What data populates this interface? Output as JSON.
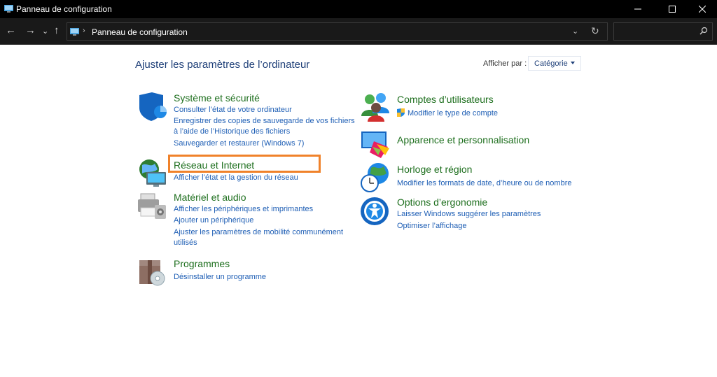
{
  "window": {
    "title": "Panneau de configuration",
    "controls": {
      "minimize": "—",
      "maximize": "☐",
      "close": "✕"
    }
  },
  "navbar": {
    "back": "←",
    "forward": "→",
    "recent": "⌄",
    "up": "↑",
    "breadcrumb_sep": "›",
    "breadcrumb": "Panneau de configuration",
    "address_dropdown": "⌄",
    "refresh": "↻",
    "search_placeholder": ""
  },
  "main": {
    "heading": "Ajuster les paramètres de l’ordinateur",
    "view_by_label": "Afficher par :",
    "view_by_value": "Catégorie"
  },
  "left_categories": [
    {
      "title": "Système et sécurité",
      "links": [
        "Consulter l’état de votre ordinateur",
        "Enregistrer des copies de sauvegarde de vos fichiers",
        "à l’aide de l’Historique des fichiers",
        "Sauvegarder et restaurer (Windows 7)"
      ]
    },
    {
      "title": "Réseau et Internet",
      "links": [
        "Afficher l’état et la gestion du réseau"
      ]
    },
    {
      "title": "Matériel et audio",
      "links": [
        "Afficher les périphériques et imprimantes",
        "Ajouter un périphérique",
        "Ajuster les paramètres de mobilité communément",
        "utilisés"
      ]
    },
    {
      "title": "Programmes",
      "links": [
        "Désinstaller un programme"
      ]
    }
  ],
  "right_categories": [
    {
      "title": "Comptes d’utilisateurs",
      "links": [
        "Modifier le type de compte"
      ]
    },
    {
      "title": "Apparence et personnalisation",
      "links": []
    },
    {
      "title": "Horloge et région",
      "links": [
        "Modifier les formats de date, d’heure ou de nombre"
      ]
    },
    {
      "title": "Options d’ergonomie",
      "links": [
        "Laisser Windows suggérer les paramètres",
        "Optimiser l’affichage"
      ]
    }
  ],
  "colors": {
    "title_green": "#1e6f1e",
    "link_blue": "#1f5fb5",
    "highlight": "#f0822a"
  }
}
